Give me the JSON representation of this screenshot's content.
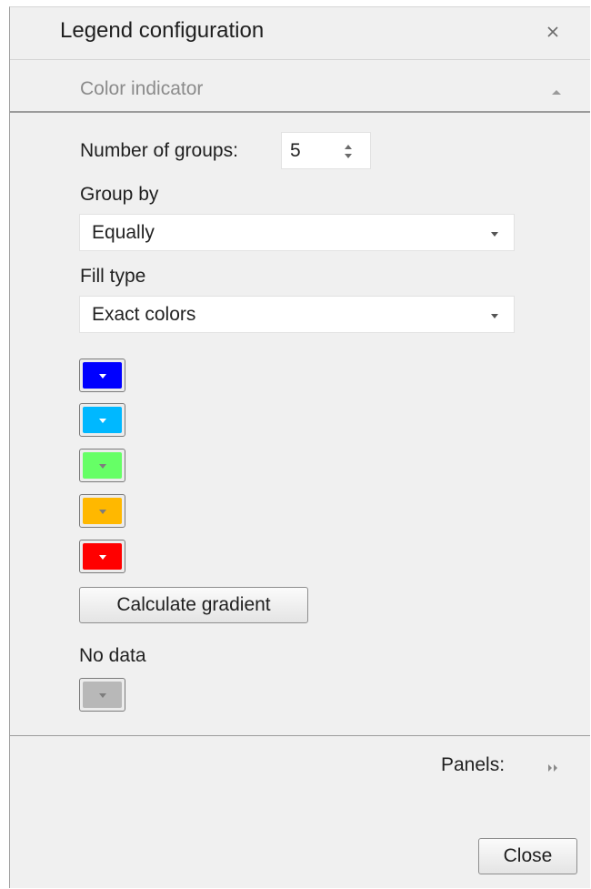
{
  "dialog": {
    "title": "Legend configuration"
  },
  "section": {
    "label": "Color indicator"
  },
  "groups": {
    "label": "Number of groups:",
    "value": "5"
  },
  "group_by": {
    "label": "Group by",
    "value": "Equally"
  },
  "fill_type": {
    "label": "Fill type",
    "value": "Exact colors"
  },
  "colors": [
    {
      "color": "#0000ff"
    },
    {
      "color": "#00b8ff"
    },
    {
      "color": "#66ff66"
    },
    {
      "color": "#ffb800"
    },
    {
      "color": "#ff0000"
    }
  ],
  "calculate_gradient_label": "Calculate gradient",
  "no_data": {
    "label": "No data",
    "color": "#b8b8b8"
  },
  "footer": {
    "panels_label": "Panels:",
    "close_label": "Close"
  },
  "icons": {
    "close": "close-icon",
    "collapse": "chevron-up-icon",
    "spinner": "spinner-arrows-icon",
    "dropdown": "chevron-down-icon",
    "panels": "double-chevron-right-icon"
  }
}
